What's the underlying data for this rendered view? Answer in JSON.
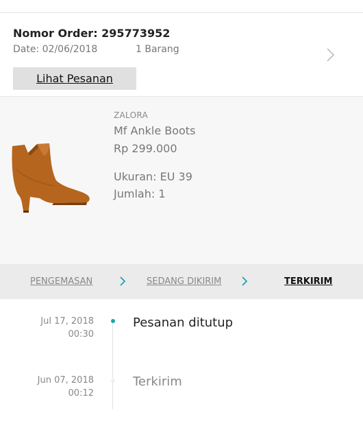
{
  "order": {
    "title": "Nomor Order: 295773952",
    "date": "Date: 02/06/2018",
    "item_count": "1 Barang",
    "view_button": "Lihat Pesanan"
  },
  "product": {
    "brand": "ZALORA",
    "name": "Mf Ankle Boots",
    "price": "Rp 299.000",
    "size": "Ukuran: EU 39",
    "quantity": "Jumlah: 1"
  },
  "status_steps": [
    "PENGEMASAN",
    "SEDANG DIKIRIM",
    "TERKIRIM"
  ],
  "timeline": [
    {
      "date": "Jul 17, 2018",
      "time": "00:30",
      "label": "Pesanan ditutup"
    },
    {
      "date": "Jun 07, 2018",
      "time": "00:12",
      "label": "Terkirim"
    }
  ],
  "icons": {
    "order_chevron": "chevron-right-icon",
    "step_chevron": "chevron-right-icon",
    "product_image": "ankle-boot-image"
  },
  "colors": {
    "accent": "#1ba3b4",
    "button_bg": "#e0e0e0",
    "status_bar_bg": "#ebebeb",
    "product_bg": "#f7f7f7"
  }
}
